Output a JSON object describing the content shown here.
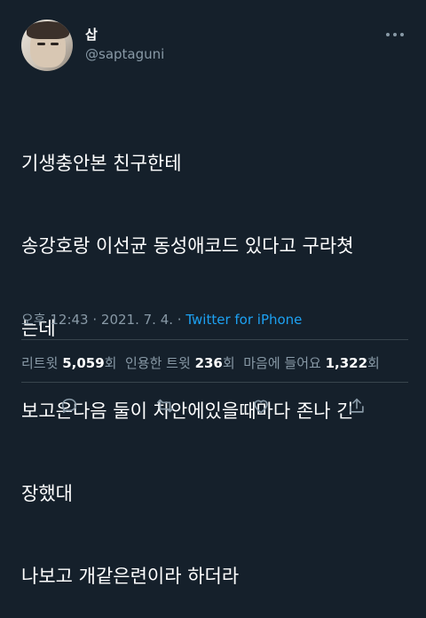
{
  "author": {
    "name": "삽",
    "handle": "@saptaguni"
  },
  "tweet": {
    "lines": [
      "기생충안본 친구한테",
      "송강호랑 이선균 동성애코드 있다고 구라쳣",
      "는데",
      "보고온다음 둘이 차안에있을때마다 존나 긴",
      "장했대",
      "나보고 개같은련이라 하더라"
    ]
  },
  "meta": {
    "time": "오후 12:43",
    "sep1": " · ",
    "date": "2021. 7. 4.",
    "sep2": " · ",
    "source": "Twitter for iPhone"
  },
  "stats": {
    "retweets_label": "리트윗",
    "retweets_count": "5,059",
    "retweets_unit": "회",
    "quotes_label": "인용한 트윗",
    "quotes_count": "236",
    "quotes_unit": "회",
    "likes_label": "마음에 들어요",
    "likes_count": "1,322",
    "likes_unit": "회"
  },
  "icons": {
    "more": "more-horizontal-icon",
    "reply": "reply-icon",
    "retweet": "retweet-icon",
    "like": "heart-icon",
    "share": "share-icon"
  },
  "colors": {
    "background": "#15202b",
    "secondary_text": "#8899a6",
    "link": "#1da1f2",
    "divider": "#38444d"
  }
}
